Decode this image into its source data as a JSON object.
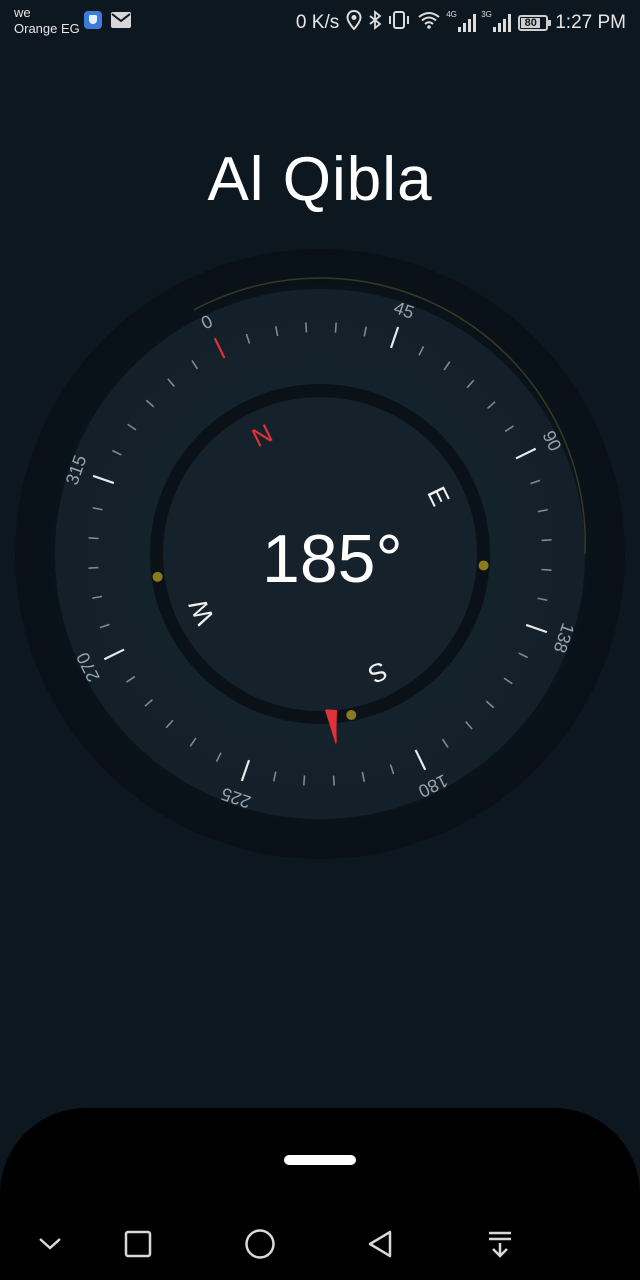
{
  "status_bar": {
    "carrier_line1": "we",
    "carrier_line2": "Orange EG",
    "left_icons": [
      "shield-icon",
      "mail-icon"
    ],
    "net_speed": "0 K/s",
    "right_icons": [
      "location-icon",
      "bluetooth-icon",
      "vibrate-icon",
      "wifi-icon",
      "signal-4g-icon",
      "signal-3g-icon"
    ],
    "signal_tags": [
      "4G",
      "3G"
    ],
    "battery": "80",
    "time": "1:27 PM"
  },
  "app": {
    "title": "Al Qibla",
    "heading": "185°"
  },
  "compass": {
    "rotation_deg": -26,
    "numeric_labels": [
      "0",
      "45",
      "90",
      "138",
      "180",
      "225",
      "270",
      "315"
    ],
    "cardinal_labels": [
      "N",
      "E",
      "S",
      "W"
    ],
    "accent_color": "#e0303a",
    "marker_color": "#8a7a1e"
  },
  "nav_bar": {
    "buttons": [
      "collapse-icon",
      "recents-icon",
      "home-icon",
      "back-icon",
      "notifications-icon"
    ]
  }
}
